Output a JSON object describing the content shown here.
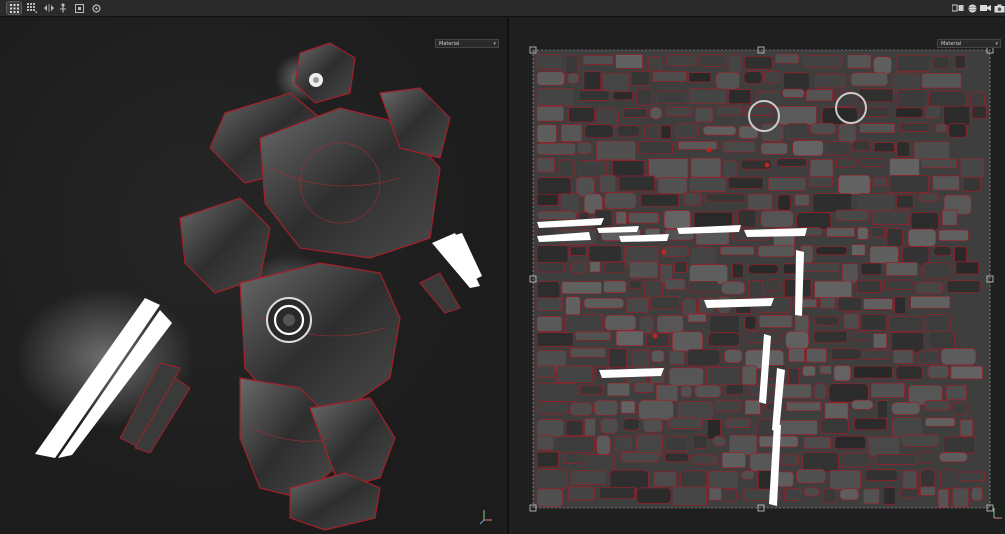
{
  "toolbar": {
    "left_tools": [
      {
        "name": "grid-view-icon",
        "active": true
      },
      {
        "name": "grid-dots-icon",
        "active": false
      },
      {
        "name": "symmetry-icon",
        "active": false
      },
      {
        "name": "transform-gizmo-icon",
        "active": false
      },
      {
        "name": "frame-icon",
        "active": false
      },
      {
        "name": "settings-icon",
        "active": false
      }
    ],
    "right_tools": [
      {
        "name": "display-mode-icon"
      },
      {
        "name": "sphere-icon"
      },
      {
        "name": "camera-icon"
      },
      {
        "name": "screenshot-icon"
      }
    ]
  },
  "viewport_3d": {
    "channel_dropdown": {
      "value": "Material"
    }
  },
  "viewport_uv": {
    "channel_dropdown": {
      "value": "Material"
    }
  },
  "colors": {
    "toolbar_bg": "#2a2a2a",
    "viewport_bg": "#1e1e1e",
    "wire_red": "#b0202a",
    "glow": "#ffffff",
    "uv_bg": "#4a4a4a"
  }
}
